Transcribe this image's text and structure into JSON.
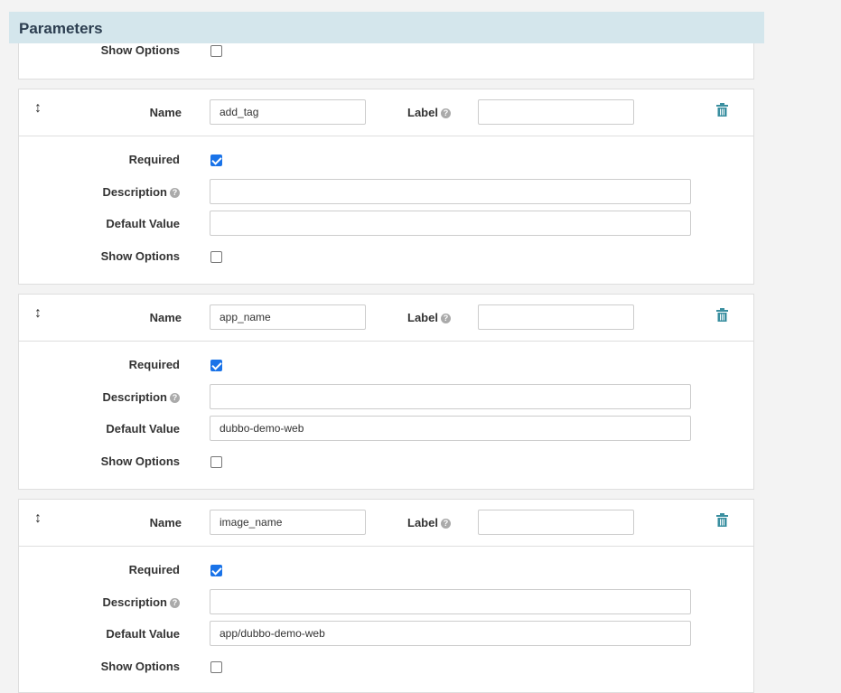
{
  "section": {
    "title": "Parameters"
  },
  "top_partial": {
    "show_options_label": "Show Options"
  },
  "icons": {
    "drag": "↕",
    "help": "?",
    "trash": "trash-icon"
  },
  "labels": {
    "name": "Name",
    "label": "Label",
    "required": "Required",
    "description": "Description",
    "default_value": "Default Value",
    "show_options": "Show Options"
  },
  "params": [
    {
      "name": "add_tag",
      "label": "",
      "required": true,
      "description": "",
      "default_value": "",
      "show_options": false
    },
    {
      "name": "app_name",
      "label": "",
      "required": true,
      "description": "",
      "default_value": "dubbo-demo-web",
      "show_options": false
    },
    {
      "name": "image_name",
      "label": "",
      "required": true,
      "description": "",
      "default_value": "app/dubbo-demo-web",
      "show_options": false
    }
  ],
  "colors": {
    "header_bg": "#d4e6ec",
    "accent": "#1a73e8",
    "trash": "#3a8fa0"
  }
}
